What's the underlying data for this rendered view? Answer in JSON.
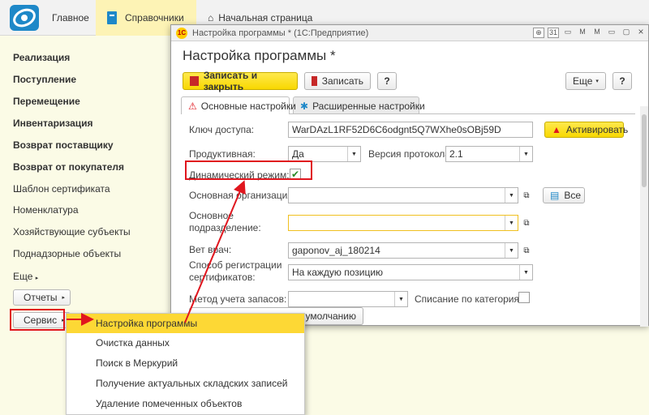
{
  "topbar": {
    "home": "Главное",
    "refs": "Справочники",
    "start_page": "Начальная страница"
  },
  "sidebar": {
    "items": [
      "Реализация",
      "Поступление",
      "Перемещение",
      "Инвентаризация",
      "Возврат поставщику",
      "Возврат от покупателя",
      "Шаблон сертификата",
      "Номенклатура",
      "Хозяйствующие субъекты",
      "Поднадзорные объекты",
      "Еще"
    ],
    "reports": "Отчеты",
    "service": "Сервис"
  },
  "window": {
    "title": "Настройка программы * (1С:Предприятие)",
    "logo": "1С",
    "form_title": "Настройка программы *",
    "btn_save_close": "Записать и закрыть",
    "btn_save": "Записать",
    "btn_help": "?",
    "btn_more": "Еще",
    "btn_help2": "?",
    "tab_main": "Основные настройки",
    "tab_ext": "Расширенные настройки"
  },
  "form": {
    "key_label": "Ключ доступа:",
    "key_value": "WarDAzL1RF52D6C6odgnt5Q7WXhe0sOBj59D",
    "activate": "Активировать",
    "prod_label": "Продуктивная:",
    "prod_value": "Да",
    "proto_label": "Версия протокола:",
    "proto_value": "2.1",
    "dyn_label": "Динамический режим:",
    "dyn_checked": true,
    "org_label": "Основная организация:",
    "org_value": "",
    "all_btn": "Все",
    "dept_label": "Основное подразделение:",
    "dept_value": "",
    "vet_label": "Вет врач:",
    "vet_value": "gaponov_aj_180214",
    "reg_label": "Способ регистрации сертификатов:",
    "reg_value": "На каждую позицию",
    "stock_label": "Метод учета запасов:",
    "stock_value": "",
    "write_off_label": "Списание по категориям:",
    "default_btn": "умолчанию"
  },
  "menu": {
    "items": [
      "Настройка программы",
      "Очистка данных",
      "Поиск в Меркурий",
      "Получение актуальных складских записей",
      "Удаление помеченных объектов"
    ]
  },
  "colors": {
    "accent": "#fdd835",
    "highlight": "#e0161e"
  }
}
